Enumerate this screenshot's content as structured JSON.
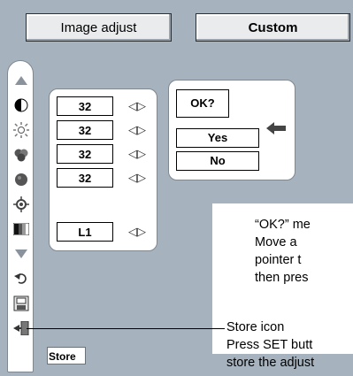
{
  "header": {
    "left_tab": "Image adjust",
    "right_tab": "Custom"
  },
  "toolbar": {
    "icons": [
      "triangle-up-icon",
      "contrast-icon",
      "brightness-icon",
      "color-icon",
      "tint-icon",
      "sharpness-icon",
      "gamma-icon",
      "triangle-down-icon",
      "reset-icon",
      "store-icon",
      "quit-icon"
    ]
  },
  "adjust": {
    "values": [
      "32",
      "32",
      "32",
      "32"
    ],
    "gamma": "L1"
  },
  "confirm": {
    "prompt": "OK?",
    "yes": "Yes",
    "no": "No"
  },
  "callout": {
    "lines": [
      "“OK?” me",
      "Move  a",
      "pointer  t",
      "then pres"
    ]
  },
  "note": {
    "line1": "Store icon",
    "line2": "Press SET butt",
    "line3": "store the adjust"
  },
  "store_tooltip": "Store"
}
